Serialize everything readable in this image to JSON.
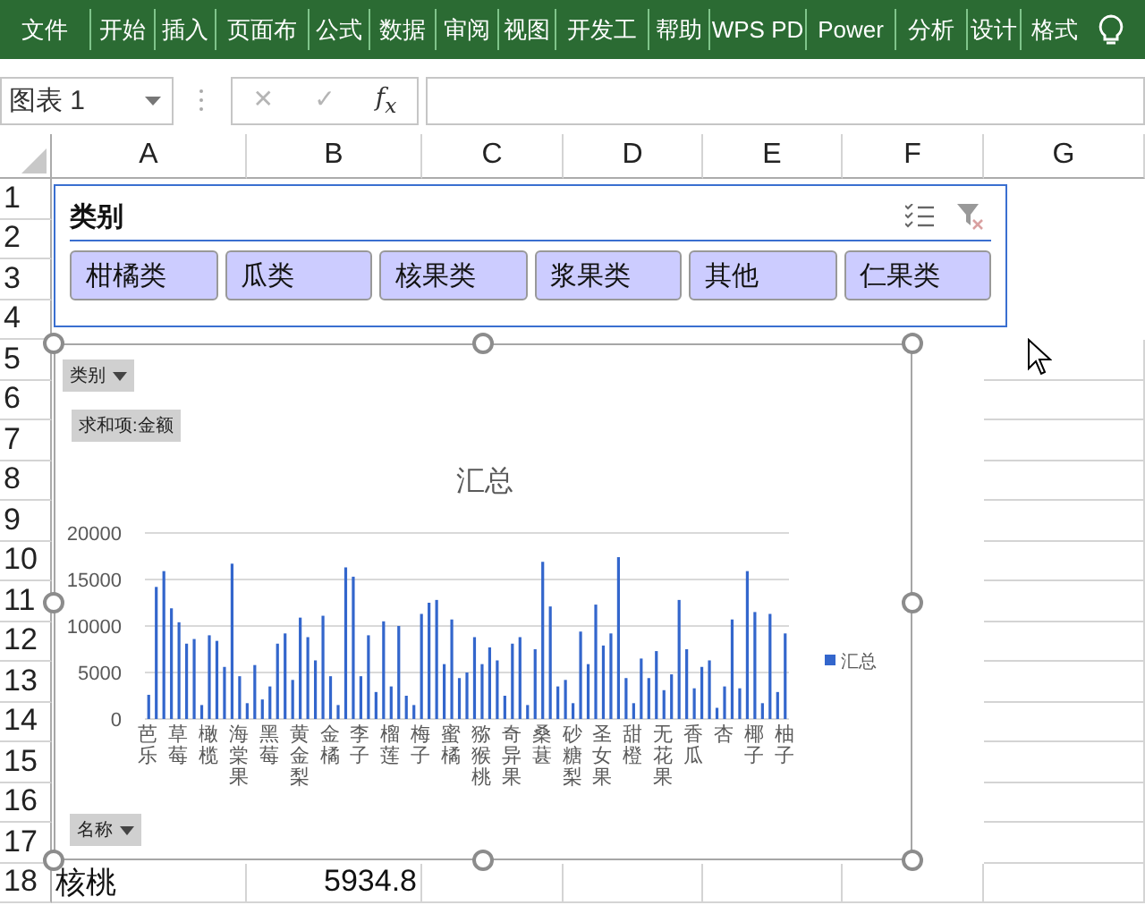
{
  "ribbon": {
    "tabs": [
      {
        "label": "文件"
      },
      {
        "label": "开始"
      },
      {
        "label": "插入"
      },
      {
        "label": "页面布"
      },
      {
        "label": "公式"
      },
      {
        "label": "数据"
      },
      {
        "label": "审阅"
      },
      {
        "label": "视图"
      },
      {
        "label": "开发工"
      },
      {
        "label": "帮助"
      },
      {
        "label": "WPS PD"
      },
      {
        "label": "Power"
      },
      {
        "label": "分析"
      },
      {
        "label": "设计"
      },
      {
        "label": "格式"
      }
    ]
  },
  "name_box": {
    "value": "图表 1"
  },
  "formula_buttons": [
    {
      "label": "✕",
      "disabled": true
    },
    {
      "label": "✓",
      "disabled": true
    },
    {
      "label": "f$_{x}$",
      "disabled": false
    }
  ],
  "columns": [
    "A",
    "B",
    "C",
    "D",
    "E",
    "F",
    "G"
  ],
  "rows": [
    {
      "label": "1"
    },
    {
      "label": "2"
    },
    {
      "label": "3"
    },
    {
      "label": "4"
    },
    {
      "label": "5"
    },
    {
      "label": "6"
    },
    {
      "label": "7"
    },
    {
      "label": "8"
    },
    {
      "label": "9"
    },
    {
      "label": "10"
    },
    {
      "label": "11"
    },
    {
      "label": "12"
    },
    {
      "label": "13"
    },
    {
      "label": "14"
    },
    {
      "label": "15"
    },
    {
      "label": "16"
    },
    {
      "label": "17"
    },
    {
      "label": "18",
      "cells": [
        "核桃",
        "5934.8"
      ]
    }
  ],
  "slicer": {
    "title": "类别",
    "items": [
      {
        "label": "柑橘类",
        "selected": true
      },
      {
        "label": "瓜类",
        "selected": true
      },
      {
        "label": "核果类",
        "selected": true
      },
      {
        "label": "浆果类",
        "selected": true
      },
      {
        "label": "其他",
        "selected": true
      },
      {
        "label": "仁果类",
        "selected": true
      }
    ]
  },
  "chart": {
    "filter_button": "类别",
    "value_button": "求和项:金额",
    "axis_button": "名称",
    "chart_data": {
      "type": "bar",
      "title": "汇总",
      "grid": true,
      "ylim": [
        0,
        20000
      ],
      "yticks": [
        0,
        5000,
        10000,
        15000,
        20000
      ],
      "categories": [
        "芭乐",
        null,
        null,
        null,
        "草莓",
        null,
        null,
        null,
        "橄榄",
        null,
        null,
        null,
        "海棠果",
        null,
        null,
        null,
        "黑莓",
        null,
        null,
        null,
        "黄金梨",
        null,
        null,
        null,
        "金橘",
        null,
        null,
        null,
        "李子",
        null,
        null,
        null,
        "榴莲",
        null,
        null,
        null,
        "梅子",
        null,
        null,
        null,
        "蜜橘",
        null,
        null,
        null,
        "猕猴桃",
        null,
        null,
        null,
        "奇异果",
        null,
        null,
        null,
        "桑葚",
        null,
        null,
        null,
        "砂糖梨",
        null,
        null,
        null,
        "圣女果",
        null,
        null,
        null,
        "甜橙",
        null,
        null,
        null,
        "无花果",
        null,
        null,
        null,
        "香瓜",
        null,
        null,
        null,
        "杏",
        null,
        null,
        null,
        "椰子",
        null,
        null,
        null,
        "柚子"
      ],
      "series": [
        {
          "name": "汇总",
          "color": "#3366cc",
          "values": [
            2600,
            14200,
            15900,
            11900,
            10400,
            8100,
            8600,
            1500,
            9000,
            8400,
            5600,
            16700,
            4600,
            1700,
            5800,
            2100,
            3500,
            8100,
            9200,
            4200,
            10900,
            8800,
            6300,
            11100,
            4600,
            1500,
            16300,
            15300,
            4600,
            9000,
            2900,
            10500,
            3500,
            10000,
            2500,
            1500,
            11300,
            12500,
            12800,
            5900,
            10700,
            4400,
            5000,
            8800,
            5900,
            7700,
            6300,
            2500,
            8100,
            8800,
            1500,
            7500,
            16900,
            12100,
            3500,
            4200,
            1700,
            9400,
            5900,
            12300,
            7900,
            9200,
            17400,
            4400,
            1700,
            6500,
            4400,
            7300,
            3100,
            4800,
            12800,
            7500,
            3300,
            5600,
            6300,
            1200,
            3500,
            10700,
            3300,
            15900,
            11500,
            1700,
            11300,
            2900,
            9200
          ]
        }
      ]
    }
  }
}
